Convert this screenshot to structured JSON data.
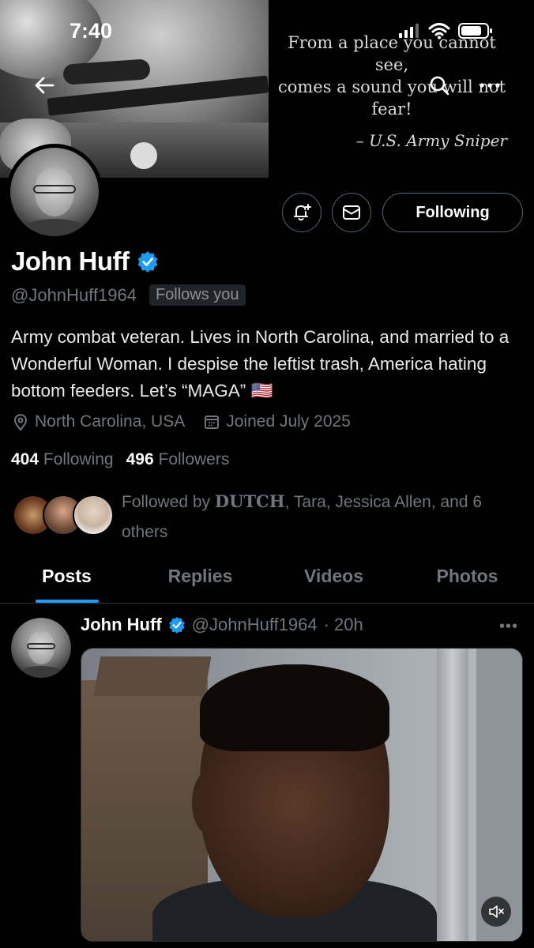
{
  "status_bar": {
    "time": "7:40"
  },
  "banner": {
    "quote_lines": [
      "From a place you cannot see,",
      "comes a sound you will not",
      "fear!"
    ],
    "quote_attribution": "– U.S. Army Sniper"
  },
  "profile": {
    "follow_button_label": "Following",
    "display_name": "John Huff",
    "handle": "@JohnHuff1964",
    "follows_you_badge": "Follows you",
    "bio": "Army combat veteran. Lives in North Carolina, and married to a Wonderful Woman. I despise the leftist trash, America hating bottom feeders. Let’s “MAGA” 🇺🇸",
    "location": "North Carolina, USA",
    "joined": "Joined July 2025",
    "following_count": "404",
    "following_label": "Following",
    "followers_count": "496",
    "followers_label": "Followers",
    "followed_by_prefix": "Followed by ",
    "followed_by_first": "DUTCH",
    "followed_by_rest": ", Tara, Jessica Allen, and 6 others"
  },
  "tabs": [
    {
      "label": "Posts",
      "active": true
    },
    {
      "label": "Replies",
      "active": false
    },
    {
      "label": "Videos",
      "active": false
    },
    {
      "label": "Photos",
      "active": false
    }
  ],
  "post": {
    "author_name": "John Huff",
    "author_handle": "@JohnHuff1964",
    "time": "· 20h",
    "more_label": "•••"
  },
  "colors": {
    "accent": "#1d9bf0",
    "muted": "#71767b",
    "border": "#2f3336"
  }
}
